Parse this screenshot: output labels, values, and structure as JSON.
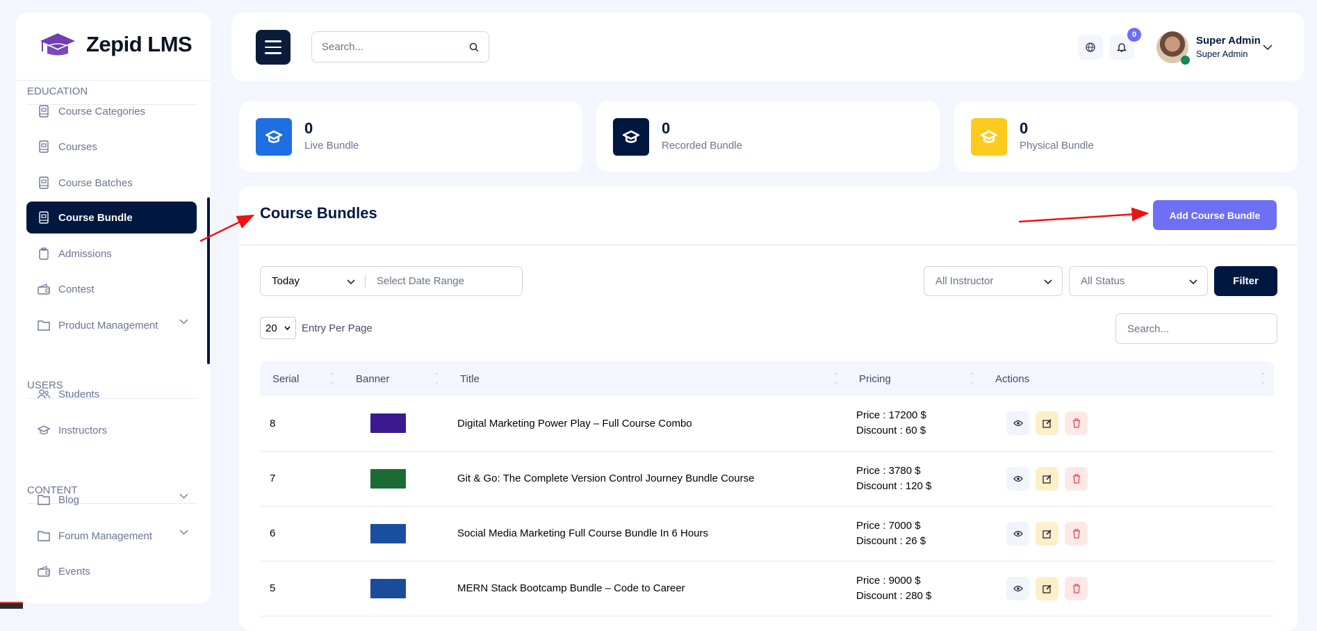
{
  "brand": {
    "name": "Zepid LMS"
  },
  "sidebar": {
    "sections": [
      "EDUCATION",
      "USERS",
      "CONTENT"
    ],
    "items": [
      {
        "label": "Course Categories",
        "icon": "book-icon"
      },
      {
        "label": "Courses",
        "icon": "book-icon"
      },
      {
        "label": "Course Batches",
        "icon": "book-icon"
      },
      {
        "label": "Course Bundle",
        "icon": "book-icon",
        "active": true
      },
      {
        "label": "Admissions",
        "icon": "clipboard-icon"
      },
      {
        "label": "Contest",
        "icon": "wallet-icon"
      },
      {
        "label": "Product Management",
        "icon": "folder-icon",
        "expandable": true
      },
      {
        "label": "Students",
        "icon": "users-icon"
      },
      {
        "label": "Instructors",
        "icon": "graduation-cap-icon"
      },
      {
        "label": "Blog",
        "icon": "folder-icon",
        "expandable": true
      },
      {
        "label": "Forum Management",
        "icon": "folder-icon",
        "expandable": true
      },
      {
        "label": "Events",
        "icon": "wallet-icon"
      }
    ]
  },
  "header": {
    "search_placeholder": "Search...",
    "notification_count": "0",
    "user": {
      "name": "Super Admin",
      "role": "Super Admin"
    }
  },
  "stats": [
    {
      "value": "0",
      "label": "Live Bundle",
      "color": "#1d6fe3"
    },
    {
      "value": "0",
      "label": "Recorded Bundle",
      "color": "#001740"
    },
    {
      "value": "0",
      "label": "Physical Bundle",
      "color": "#fdcb1d"
    }
  ],
  "main": {
    "title": "Course Bundles",
    "add_label": "Add Course Bundle",
    "filters": {
      "date_preset": "Today",
      "date_range_placeholder": "Select Date Range",
      "instructor": "All Instructor",
      "status": "All Status",
      "filter_label": "Filter"
    },
    "per_page": "20",
    "per_page_label": "Entry Per Page",
    "search_placeholder": "Search...",
    "columns": [
      "Serial",
      "Banner",
      "Title",
      "Pricing",
      "Actions"
    ],
    "rows": [
      {
        "serial": "8",
        "banner_color": "#3b1a8f",
        "title": "Digital Marketing Power Play – Full Course Combo",
        "price": "Price : 17200 $",
        "discount": "Discount : 60 $"
      },
      {
        "serial": "7",
        "banner_color": "#1c6b35",
        "title": "Git & Go: The Complete Version Control Journey Bundle Course",
        "price": "Price : 3780 $",
        "discount": "Discount : 120 $"
      },
      {
        "serial": "6",
        "banner_color": "#1a4fa0",
        "title": "Social Media Marketing Full Course Bundle In 6 Hours",
        "price": "Price : 7000 $",
        "discount": "Discount : 26 $"
      },
      {
        "serial": "5",
        "banner_color": "#1b4c9a",
        "title": "MERN Stack Bootcamp Bundle – Code to Career",
        "price": "Price : 9000 $",
        "discount": "Discount : 280 $"
      }
    ]
  },
  "colors": {
    "primary": "#001740",
    "accent": "#6d6ff5",
    "annotation": "#ee1111"
  }
}
